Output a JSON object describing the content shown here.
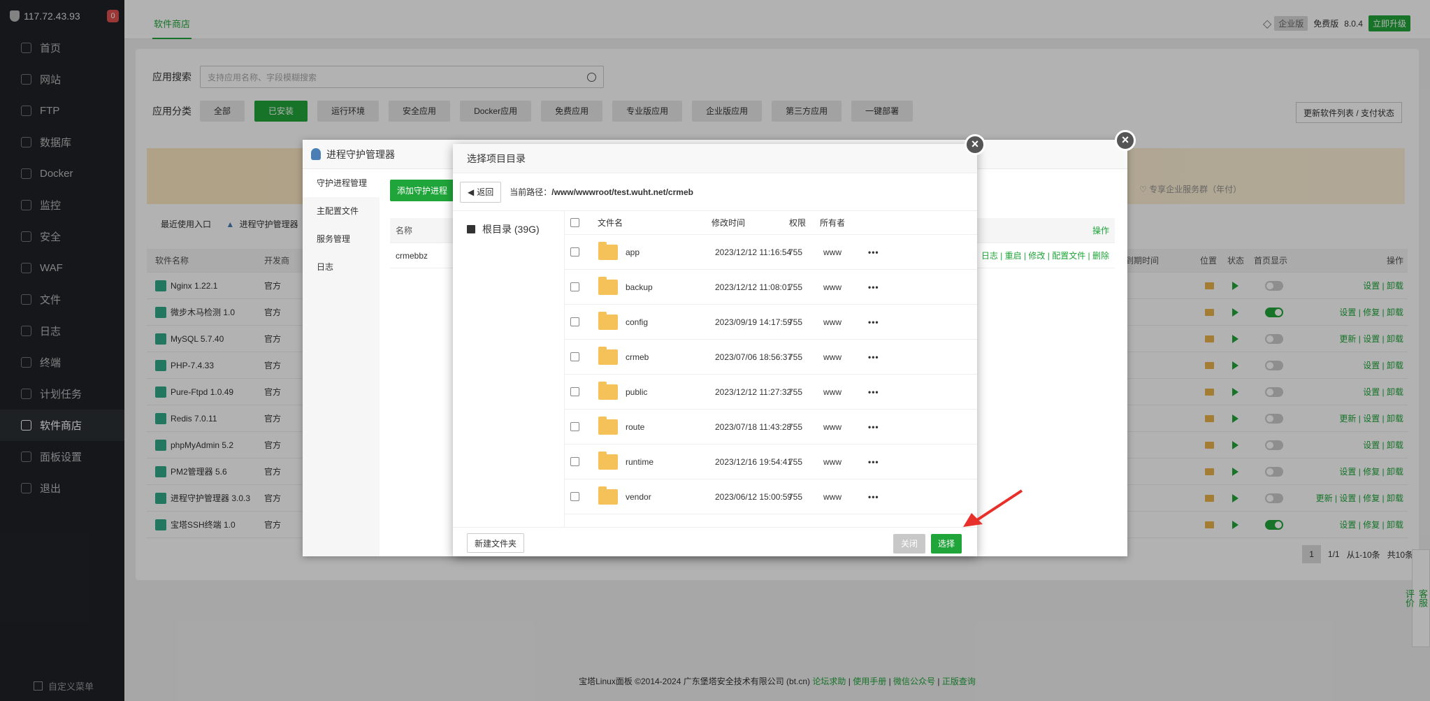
{
  "sidebar": {
    "ip": "117.72.43.93",
    "badge": "0",
    "items": [
      {
        "label": "首页"
      },
      {
        "label": "网站"
      },
      {
        "label": "FTP"
      },
      {
        "label": "数据库"
      },
      {
        "label": "Docker"
      },
      {
        "label": "监控"
      },
      {
        "label": "安全"
      },
      {
        "label": "WAF"
      },
      {
        "label": "文件"
      },
      {
        "label": "日志"
      },
      {
        "label": "终端"
      },
      {
        "label": "计划任务"
      },
      {
        "label": "软件商店"
      },
      {
        "label": "面板设置"
      },
      {
        "label": "退出"
      }
    ],
    "footer": "自定义菜单"
  },
  "topbar": {
    "tab": "软件商店",
    "enterprise": "企业版",
    "free": "免费版",
    "version": "8.0.4",
    "upgrade": "立即升级"
  },
  "store": {
    "search_label": "应用搜索",
    "search_placeholder": "支持应用名称、字段模糊搜索",
    "category_label": "应用分类",
    "categories": [
      "全部",
      "已安装",
      "运行环境",
      "安全应用",
      "Docker应用",
      "免费应用",
      "专业版应用",
      "企业版应用",
      "第三方应用",
      "一键部署"
    ],
    "update_btn": "更新软件列表 / 支付状态",
    "recent_label": "最近使用入口",
    "recent_item": "进程守护管理器",
    "headers": {
      "name": "软件名称",
      "dev": "开发商",
      "expire": "到期时间",
      "pos": "位置",
      "status": "状态",
      "home": "首页显示",
      "ops": "操作"
    },
    "rows": [
      {
        "name": "Nginx 1.22.1",
        "dev": "官方",
        "on": false,
        "ops": "设置 | 卸载"
      },
      {
        "name": "微步木马检测 1.0",
        "dev": "官方",
        "on": true,
        "ops": "设置 | 修复 | 卸载"
      },
      {
        "name": "MySQL 5.7.40",
        "dev": "官方",
        "on": false,
        "ops": "更新 | 设置 | 卸载"
      },
      {
        "name": "PHP-7.4.33",
        "dev": "官方",
        "on": false,
        "ops": "设置 | 卸载"
      },
      {
        "name": "Pure-Ftpd 1.0.49",
        "dev": "官方",
        "on": false,
        "ops": "设置 | 卸载"
      },
      {
        "name": "Redis 7.0.11",
        "dev": "官方",
        "on": false,
        "ops": "更新 | 设置 | 卸载"
      },
      {
        "name": "phpMyAdmin 5.2",
        "dev": "官方",
        "on": false,
        "ops": "设置 | 卸载"
      },
      {
        "name": "PM2管理器 5.6",
        "dev": "官方",
        "on": false,
        "ops": "设置 | 修复 | 卸载"
      },
      {
        "name": "进程守护管理器 3.0.3",
        "dev": "官方",
        "on": false,
        "ops": "更新 | 设置 | 修复 | 卸载"
      },
      {
        "name": "宝塔SSH终端 1.0",
        "dev": "官方",
        "on": true,
        "ops": "设置 | 修复 | 卸载"
      }
    ],
    "pager": {
      "page": "1",
      "pages": "1/1",
      "range": "从1-10条",
      "total": "共10条"
    }
  },
  "service": {
    "kefu": "客服",
    "rate": "评价"
  },
  "footer": {
    "copyright": "宝塔Linux面板 ©2014-2024 广东堡塔安全技术有限公司 (bt.cn)",
    "links": [
      "论坛求助",
      "使用手册",
      "微信公众号",
      "正版查询"
    ]
  },
  "supervisor": {
    "title": "进程守护管理器",
    "menu": [
      "守护进程管理",
      "主配置文件",
      "服务管理",
      "日志"
    ],
    "add_btn": "添加守护进程",
    "enterprise_note": "专享企业服务群（年付）",
    "col_name": "名称",
    "col_ops": "操作",
    "row_name": "crmebbz",
    "row_ops": "日志 | 重启 | 修改 | 配置文件 | 删除"
  },
  "dialog": {
    "title": "选择项目目录",
    "back": "返回",
    "path_label": "当前路径：",
    "path": "/www/wwwroot/test.wuht.net/crmeb",
    "root": "根目录 (39G)",
    "headers": {
      "name": "文件名",
      "mtime": "修改时间",
      "perm": "权限",
      "owner": "所有者"
    },
    "files": [
      {
        "name": "app",
        "mtime": "2023/12/12 11:16:54",
        "perm": "755",
        "owner": "www"
      },
      {
        "name": "backup",
        "mtime": "2023/12/12 11:08:01",
        "perm": "755",
        "owner": "www"
      },
      {
        "name": "config",
        "mtime": "2023/09/19 14:17:59",
        "perm": "755",
        "owner": "www"
      },
      {
        "name": "crmeb",
        "mtime": "2023/07/06 18:56:37",
        "perm": "755",
        "owner": "www"
      },
      {
        "name": "public",
        "mtime": "2023/12/12 11:27:32",
        "perm": "755",
        "owner": "www"
      },
      {
        "name": "route",
        "mtime": "2023/07/18 11:43:28",
        "perm": "755",
        "owner": "www"
      },
      {
        "name": "runtime",
        "mtime": "2023/12/16 19:54:41",
        "perm": "755",
        "owner": "www"
      },
      {
        "name": "vendor",
        "mtime": "2023/06/12 15:00:59",
        "perm": "755",
        "owner": "www"
      }
    ],
    "new_folder": "新建文件夹",
    "close": "关闭",
    "select": "选择"
  },
  "colors": {
    "accent": "#20a53a",
    "sidebar_bg": "#1f2226",
    "annotation_arrow": "#e8302a"
  }
}
